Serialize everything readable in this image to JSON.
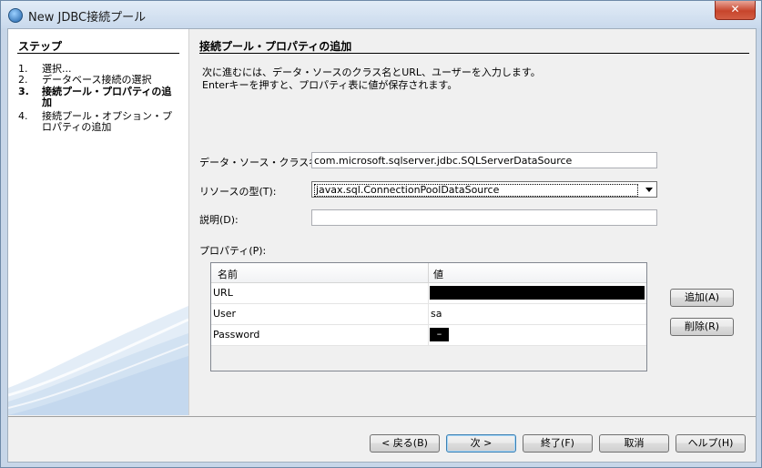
{
  "window": {
    "title": "New JDBC接続プール",
    "close_glyph": "✕"
  },
  "steps": {
    "title": "ステップ",
    "items": [
      {
        "num": "1.",
        "label": "選択..."
      },
      {
        "num": "2.",
        "label": "データベース接続の選択"
      },
      {
        "num": "3.",
        "label": "接続プール・プロパティの追加"
      },
      {
        "num": "4.",
        "label": "接続プール・オプション・プロパティの追加"
      }
    ],
    "active_index": 2
  },
  "main": {
    "title": "接続プール・プロパティの追加",
    "desc_line1": "次に進むには、データ・ソースのクラス名とURL、ユーザーを入力します。",
    "desc_line2": "Enterキーを押すと、プロパティ表に値が保存されます。",
    "datasource_label": "データ・ソース・クラス名(C):",
    "datasource_value": "com.microsoft.sqlserver.jdbc.SQLServerDataSource",
    "resource_type_label": "リソースの型(T):",
    "resource_type_value": "javax.sql.ConnectionPoolDataSource",
    "description_label": "説明(D):",
    "description_value": "",
    "properties_label": "プロパティ(P):",
    "table": {
      "col_name": "名前",
      "col_value": "値",
      "rows": [
        {
          "name": "URL",
          "value": ""
        },
        {
          "name": "User",
          "value": "sa"
        },
        {
          "name": "Password",
          "value": "–"
        }
      ]
    },
    "add_button": "追加(A)",
    "delete_button": "削除(R)"
  },
  "footer": {
    "back": "< 戻る(B)",
    "next": "次 >",
    "finish": "終了(F)",
    "cancel": "取消",
    "help": "ヘルプ(H)"
  }
}
